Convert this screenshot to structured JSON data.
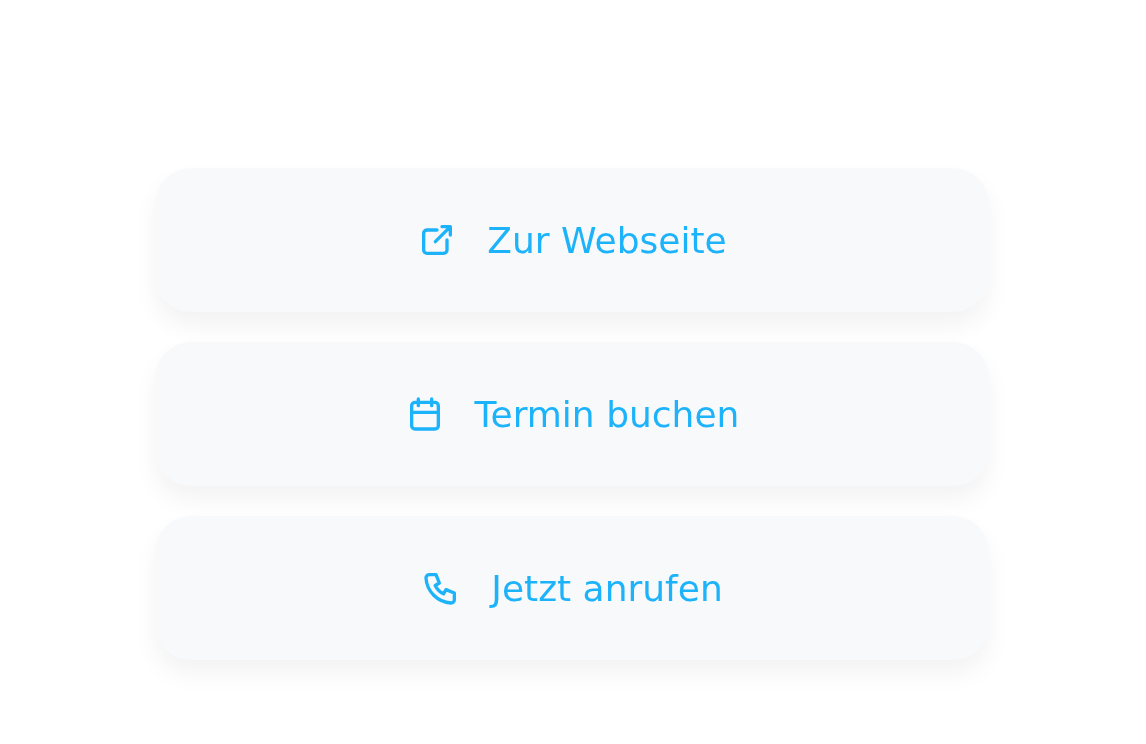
{
  "buttons": [
    {
      "label": "Zur Webseite",
      "kind": "link"
    },
    {
      "label": "Termin buchen",
      "kind": "booking"
    },
    {
      "label": "Jetzt anrufen",
      "kind": "call"
    }
  ]
}
